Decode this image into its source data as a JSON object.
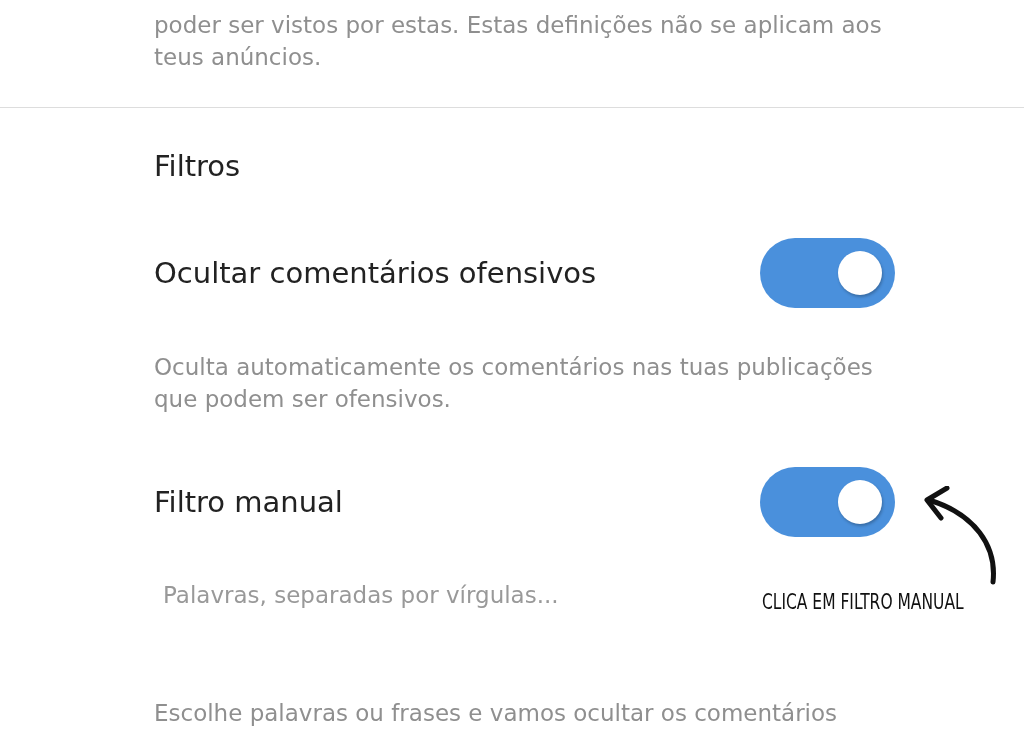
{
  "top_note": "poder ser vistos por estas. Estas definições não se aplicam aos teus anúncios.",
  "section_title": "Filtros",
  "settings": [
    {
      "label": "Ocultar comentários ofensivos",
      "on": true,
      "description": "Oculta automaticamente os comentários nas tuas publicações que podem ser ofensivos."
    },
    {
      "label": "Filtro manual",
      "on": true,
      "field": {
        "placeholder": "Palavras, separadas por vírgulas..."
      },
      "description": "Escolhe palavras ou frases e vamos ocultar os comentários"
    }
  ],
  "annotation": "CLICA EM FILTRO MANUAL"
}
